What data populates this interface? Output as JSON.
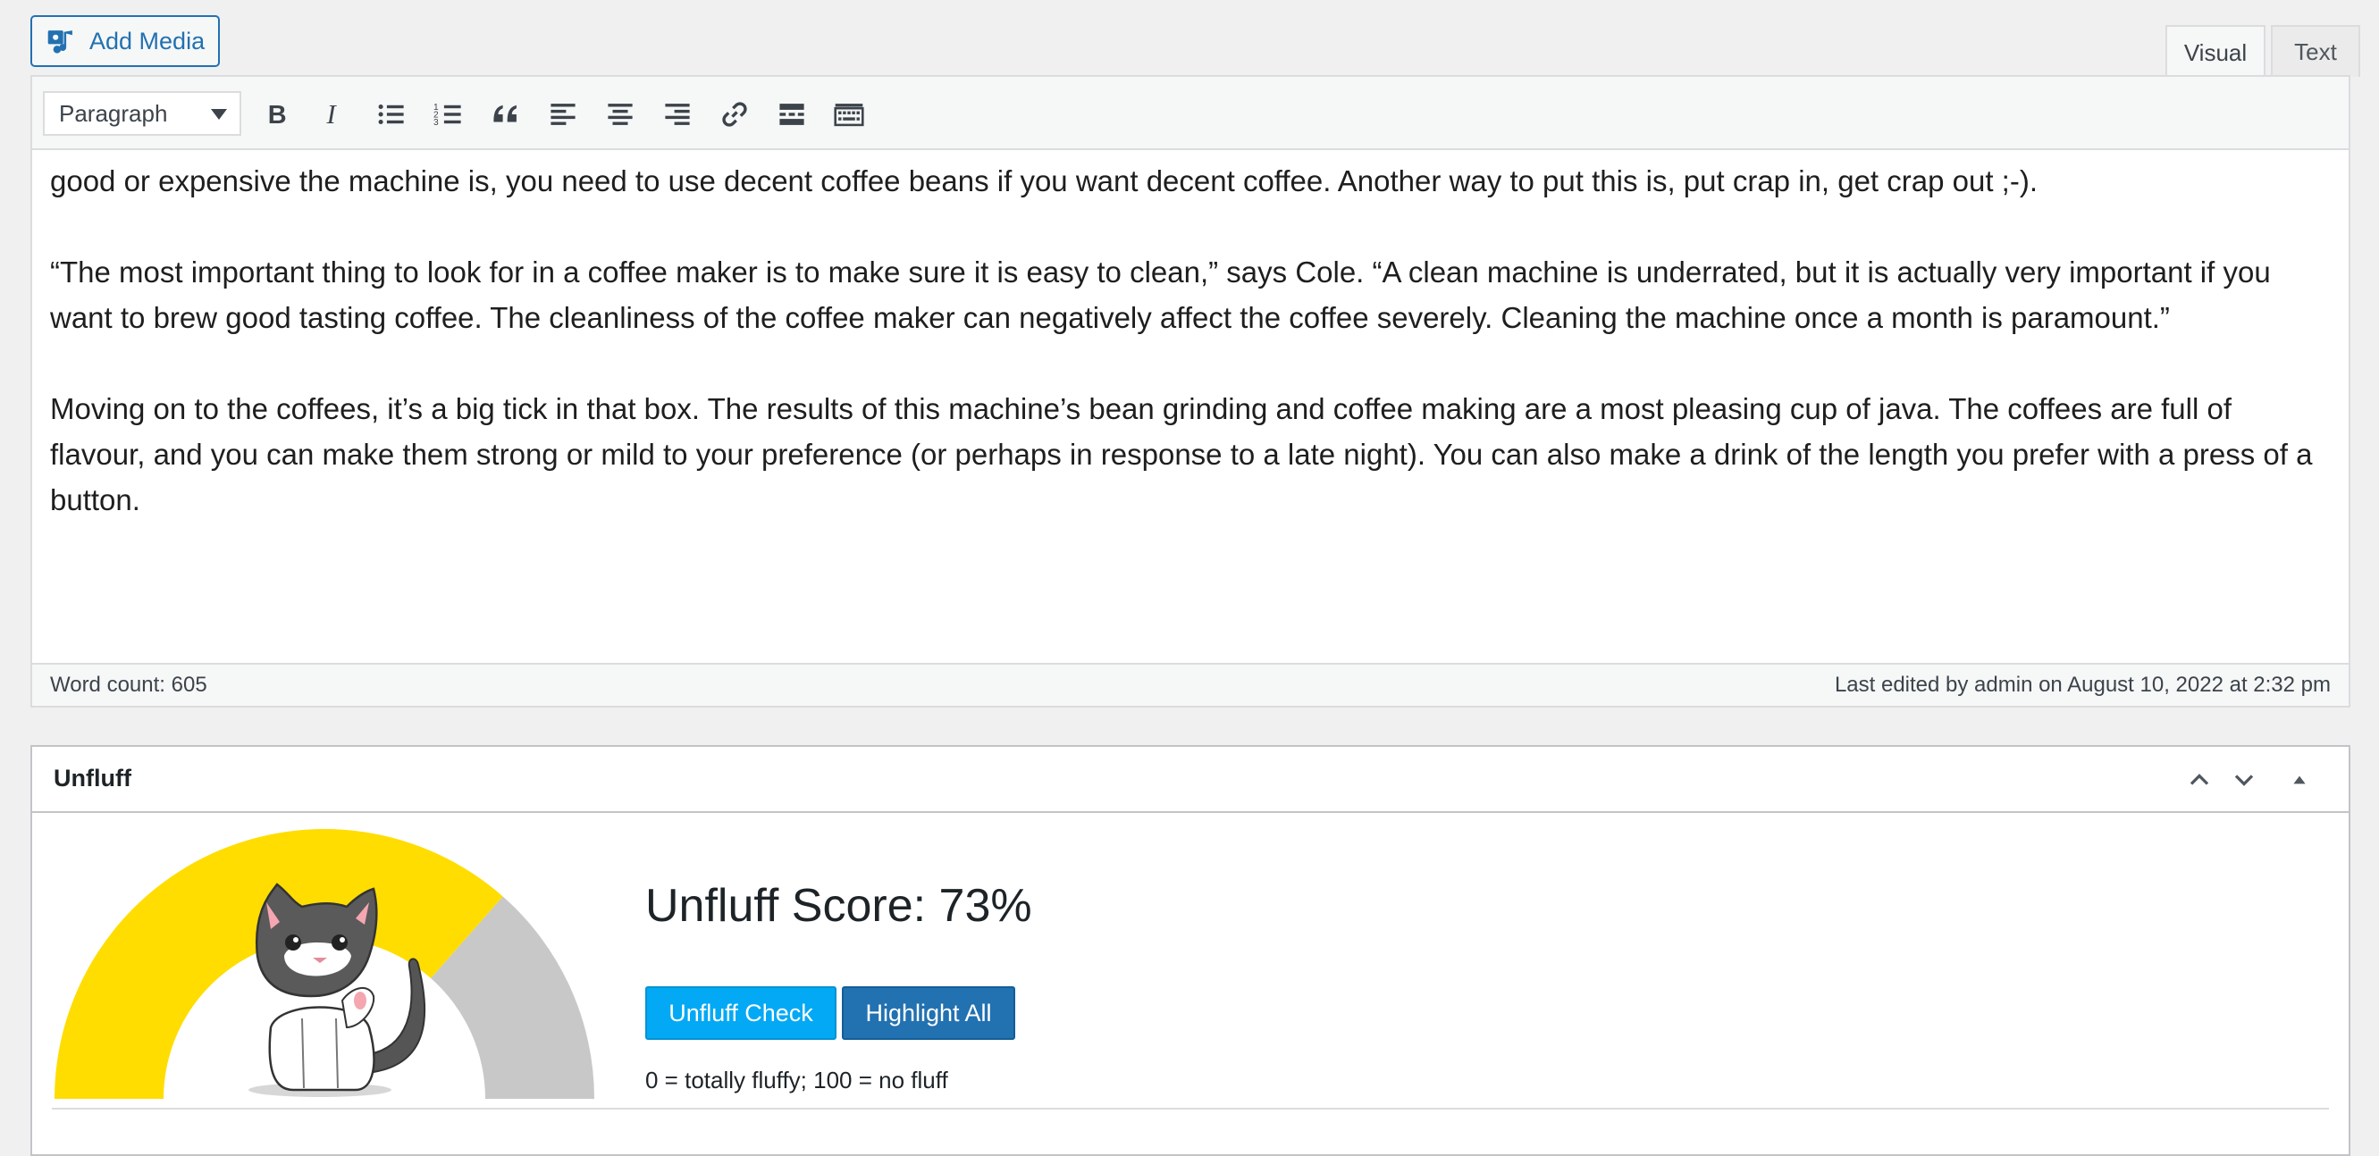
{
  "header": {
    "add_media_label": "Add Media",
    "tabs": [
      {
        "label": "Visual",
        "active": true
      },
      {
        "label": "Text",
        "active": false
      }
    ]
  },
  "toolbar": {
    "format_value": "Paragraph",
    "buttons": [
      "bold-icon",
      "italic-icon",
      "bullet-list-icon",
      "numbered-list-icon",
      "blockquote-icon",
      "align-left-icon",
      "align-center-icon",
      "align-right-icon",
      "link-icon",
      "read-more-icon",
      "toolbar-toggle-icon"
    ]
  },
  "editor": {
    "paragraphs": [
      "good or expensive the machine is, you need to use decent coffee beans if you want decent coffee. Another way to put this is, put crap in, get crap out ;-).",
      "“The most important thing to look for in a coffee maker is to make sure it is easy to clean,” says Cole. “A clean machine is underrated, but it is actually very important if you want to brew good tasting coffee. The cleanliness of the coffee maker can negatively affect the coffee severely. Cleaning the machine once a month is paramount.”",
      "Moving on to the coffees, it’s a big tick in that box. The results of this machine’s bean grinding and coffee making are a most pleasing cup of java. The coffees are full of flavour, and you can make them strong or mild to your preference (or perhaps in response to a late night). You can also make a drink of the length you prefer with a press of a button."
    ],
    "word_count": "Word count: 605",
    "last_edited": "Last edited by admin on August 10, 2022 at 2:32 pm"
  },
  "unfluff": {
    "title": "Unfluff",
    "score_text": "Unfluff Score: 73%",
    "score_value": 73,
    "check_label": "Unfluff Check",
    "highlight_label": "Highlight All",
    "legend": "0 = totally fluffy; 100 = no fluff",
    "colors": {
      "gauge_fill": "#ffdd00",
      "gauge_rest": "#c8c8c8",
      "check_btn": "#03a9f4",
      "highlight_btn": "#2271b1"
    }
  }
}
